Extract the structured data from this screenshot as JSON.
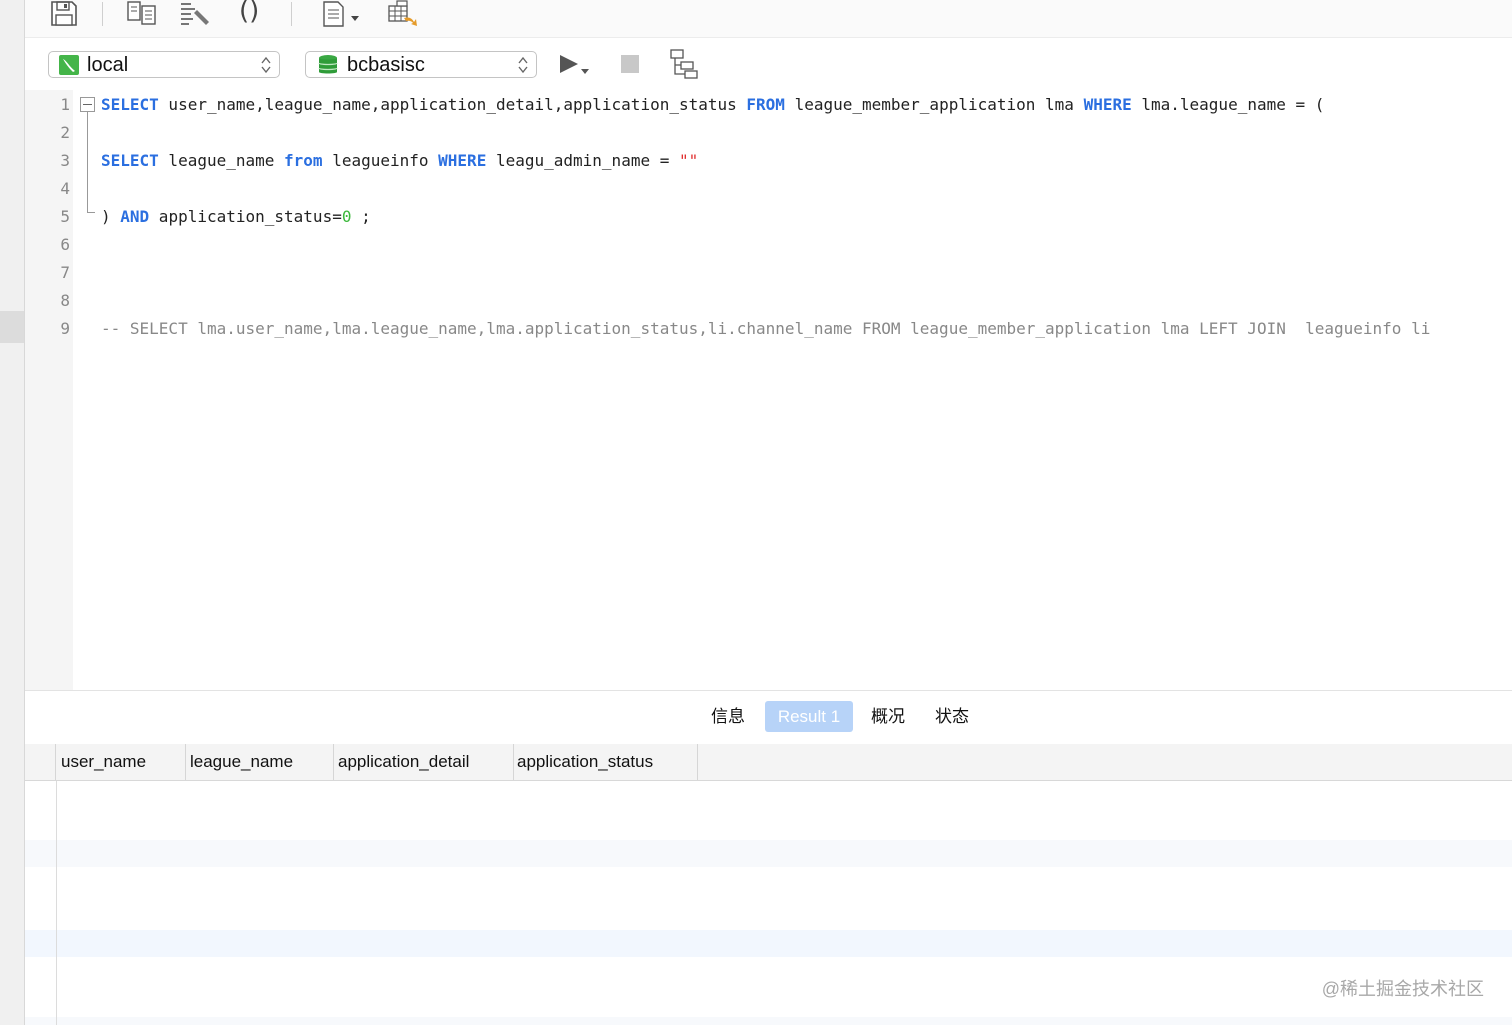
{
  "toolbar": {
    "icons": [
      "save-icon",
      "compare-icon",
      "format-icon",
      "parentheses-icon",
      "snippet-icon",
      "export-table-icon"
    ],
    "parentheses_glyph": "()"
  },
  "connection": {
    "selected": "local",
    "icon": "connection-icon"
  },
  "database": {
    "selected": "bcbasisc",
    "icon": "database-icon"
  },
  "run_controls": {
    "icons": [
      "run-icon",
      "stop-icon",
      "explain-icon"
    ]
  },
  "editor": {
    "line_numbers": [
      "1",
      "2",
      "3",
      "4",
      "5",
      "6",
      "7",
      "8",
      "9"
    ],
    "line1": {
      "kw1": "SELECT",
      "t1": " user_name,league_name,application_detail,application_status ",
      "kw2": "FROM",
      "t2": " league_member_application lma ",
      "kw3": "WHERE",
      "t3": " lma.league_name = ("
    },
    "line3": {
      "kw1": "SELECT",
      "t1": " league_name ",
      "kw2": "from",
      "t2": " leagueinfo ",
      "kw3": "WHERE",
      "t3": " leagu_admin_name = ",
      "str": "\"\""
    },
    "line5": {
      "t0": ") ",
      "kw1": "AND",
      "t1": " application_status=",
      "num": "0",
      "t2": " ;"
    },
    "line9": "-- SELECT lma.user_name,lma.league_name,lma.application_status,li.channel_name FROM league_member_application lma LEFT JOIN  leagueinfo li"
  },
  "result_tabs": [
    {
      "label": "信息",
      "active": false
    },
    {
      "label": "Result 1",
      "active": true
    },
    {
      "label": "概况",
      "active": false
    },
    {
      "label": "状态",
      "active": false
    }
  ],
  "grid": {
    "columns": [
      "user_name",
      "league_name",
      "application_detail",
      "application_status"
    ],
    "rows": []
  },
  "colors": {
    "keyword": "#2b6fe0",
    "number": "#3bb83b",
    "string": "#e03030",
    "comment": "#888888",
    "active_tab": "#b7d3f8"
  },
  "watermark": "@稀土掘金技术社区"
}
